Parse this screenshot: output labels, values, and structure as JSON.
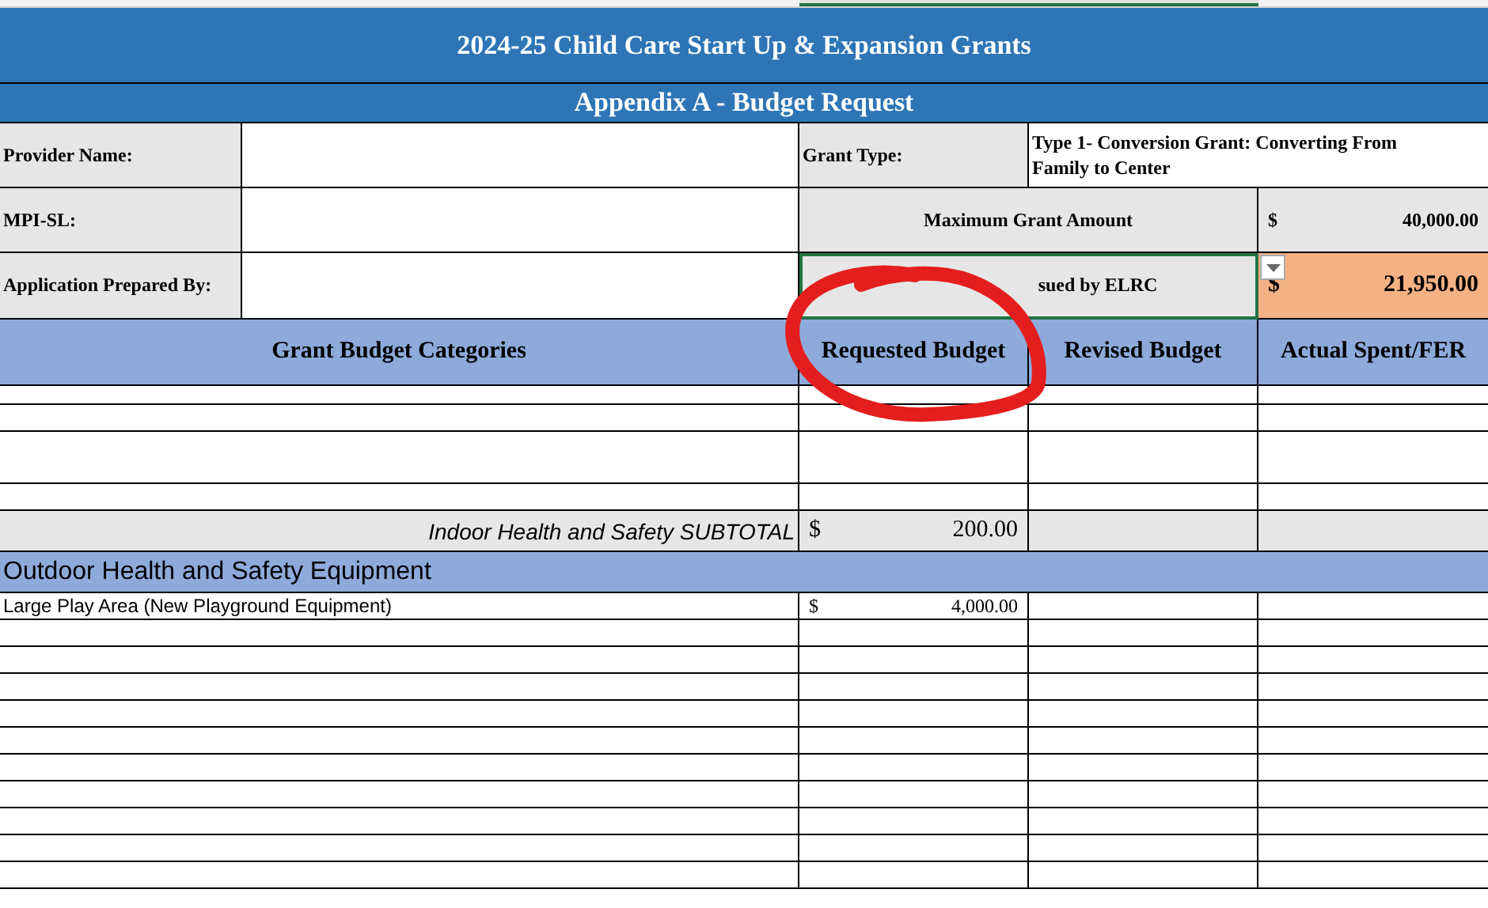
{
  "title": "2024-25 Child Care Start Up & Expansion Grants",
  "subtitle": "Appendix A - Budget Request",
  "provider_name": {
    "label": "Provider Name:"
  },
  "mpi_sl": {
    "label": "MPI-SL:"
  },
  "prepared_by": {
    "label": "Application Prepared By:"
  },
  "grant_type": {
    "label": "Grant Type:",
    "value": "Type 1- Conversion Grant: Converting From Family to Center"
  },
  "maximum_grant": {
    "label": "Maximum Grant Amount",
    "currency": "$",
    "amount": "40,000.00"
  },
  "amount_issued": {
    "label": "sued by ELRC",
    "currency": "$",
    "amount": "21,950.00"
  },
  "columns": [
    "Grant Budget Categories",
    "Requested Budget",
    "Revised Budget",
    "Actual Spent/FER"
  ],
  "rows": [
    {
      "kind": "short"
    },
    {
      "kind": "blank"
    },
    {
      "kind": "tall"
    },
    {
      "kind": "blank"
    },
    {
      "kind": "subtotal",
      "label": "Indoor Health and Safety SUBTOTAL",
      "currency": "$",
      "amount": "200.00"
    },
    {
      "kind": "section",
      "label": "Outdoor Health and Safety Equipment"
    },
    {
      "kind": "item",
      "label": "Large Play Area (New Playground Equipment)",
      "currency": "$",
      "amount": "4,000.00"
    },
    {
      "kind": "blank"
    },
    {
      "kind": "blank"
    },
    {
      "kind": "blank"
    },
    {
      "kind": "blank"
    },
    {
      "kind": "blank"
    },
    {
      "kind": "blank"
    },
    {
      "kind": "blank"
    },
    {
      "kind": "blank"
    },
    {
      "kind": "blank"
    },
    {
      "kind": "blank"
    }
  ]
}
